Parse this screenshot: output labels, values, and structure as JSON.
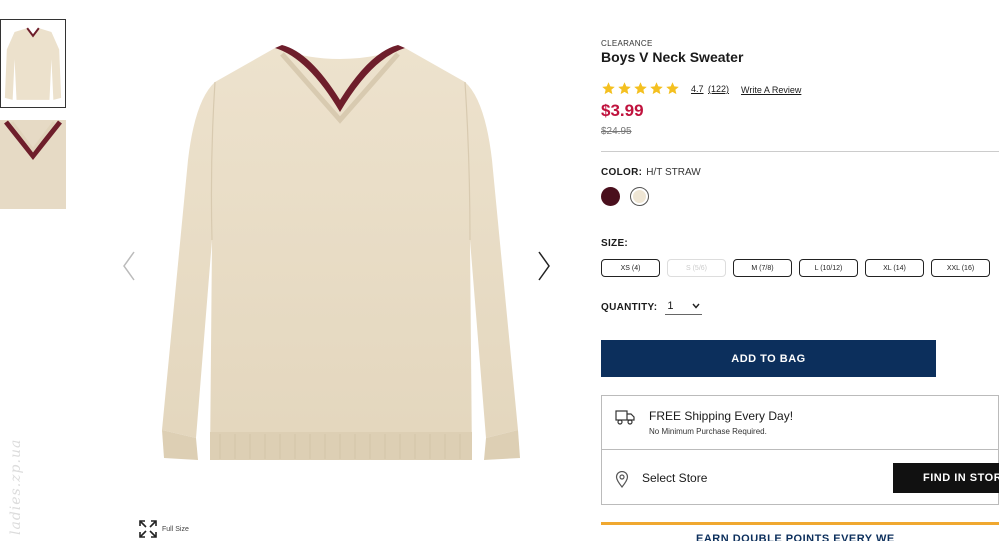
{
  "product": {
    "badge": "CLEARANCE",
    "title": "Boys V Neck Sweater",
    "rating": "4.7",
    "reviews": "(122)",
    "write_review": "Write A Review",
    "price": "$3.99",
    "old_price": "$24.95",
    "star_count": 5
  },
  "color": {
    "label": "COLOR:",
    "value": "H/T STRAW",
    "swatches": [
      "#4a0f1d",
      "#efe6d4"
    ]
  },
  "size": {
    "label": "SIZE:",
    "options": [
      "XS (4)",
      "S (5/6)",
      "M (7/8)",
      "L (10/12)",
      "XL (14)",
      "XXL (16)"
    ]
  },
  "quantity": {
    "label": "QUANTITY:",
    "value": "1"
  },
  "actions": {
    "add_to_bag": "ADD TO BAG",
    "find_in_store": "FIND IN STORE"
  },
  "shipping": {
    "title": "FREE Shipping Every Day!",
    "subtitle": "No Minimum Purchase Required.",
    "select_store": "Select Store"
  },
  "gallery": {
    "full_size": "Full Size",
    "watermark": "ladies.zp.ua"
  },
  "promo": {
    "text": "EARN DOUBLE POINTS EVERY WE"
  },
  "colors": {
    "accent_red": "#c0133e",
    "navy": "#0c2f5c",
    "star_gold": "#f4c020",
    "promo_orange": "#f0a830"
  }
}
